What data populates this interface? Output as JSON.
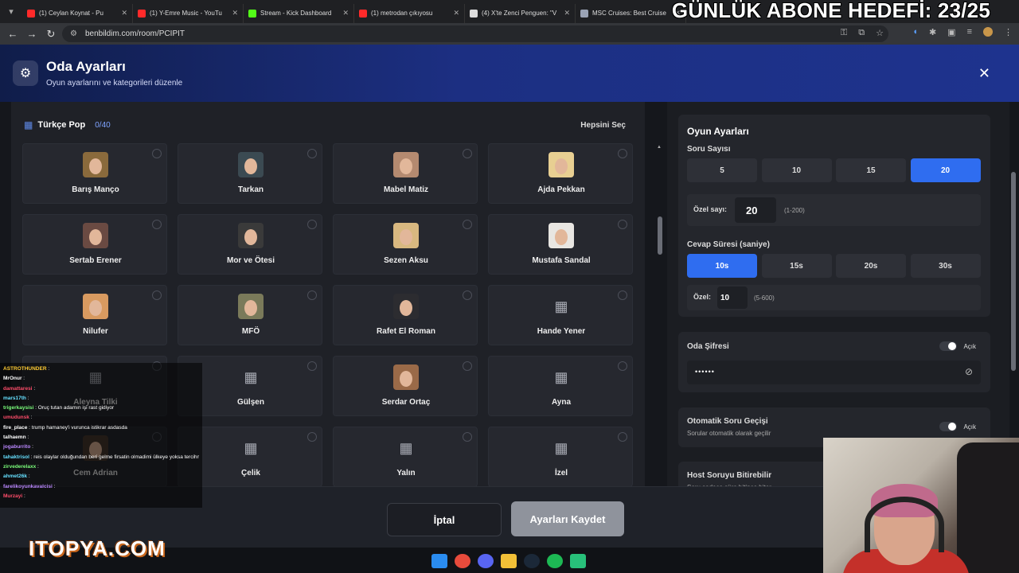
{
  "browser": {
    "tabs": [
      {
        "label": "(1) Ceylan Koynat - Pu",
        "color": "#ff2a2a"
      },
      {
        "label": "(1) Y-Emre Music - YouTu",
        "color": "#ff2a2a"
      },
      {
        "label": "Stream - Kick Dashboard",
        "color": "#53fc18"
      },
      {
        "label": "(1) metrodan çıkıyosu",
        "color": "#ff2a2a"
      },
      {
        "label": "(4) X'te Zenci Penguen: \"V",
        "color": "#dddddd"
      },
      {
        "label": "MSC Cruises: Best Cruise",
        "color": "#9aa3b5"
      }
    ],
    "url": "benbildim.com/room/PCIPIT",
    "goal_text": "GÜNLÜK ABONE HEDEFİ: 23/25"
  },
  "header": {
    "title": "Oda Ayarları",
    "subtitle": "Oyun ayarlarını ve kategorileri düzenle"
  },
  "category": {
    "name": "Türkçe Pop",
    "count": "0/40",
    "select_all": "Hepsini Seç",
    "artists": [
      {
        "name": "Barış Manço",
        "avatar": "#8a6a3c"
      },
      {
        "name": "Tarkan",
        "avatar": "#3b4a52"
      },
      {
        "name": "Mabel Matiz",
        "avatar": "#b48a70"
      },
      {
        "name": "Ajda Pekkan",
        "avatar": "#e8cf92"
      },
      {
        "name": "Sertab Erener",
        "avatar": "#6a4a42"
      },
      {
        "name": "Mor ve Ötesi",
        "avatar": "#3a3a3a"
      },
      {
        "name": "Sezen Aksu",
        "avatar": "#d8b880"
      },
      {
        "name": "Mustafa Sandal",
        "avatar": "#e8e6e2"
      },
      {
        "name": "Nilufer",
        "avatar": "#d89a60"
      },
      {
        "name": "MFÖ",
        "avatar": "#7a7a5a"
      },
      {
        "name": "Rafet El Roman",
        "avatar": "#2c2c30"
      },
      {
        "name": "Hande Yener",
        "avatar": ""
      },
      {
        "name": "Aleyna Tilki",
        "avatar": ""
      },
      {
        "name": "Gülşen",
        "avatar": ""
      },
      {
        "name": "Serdar Ortaç",
        "avatar": "#9a6a48"
      },
      {
        "name": "Ayna",
        "avatar": ""
      },
      {
        "name": "Cem Adrian",
        "avatar": "#4a3a30"
      },
      {
        "name": "Çelik",
        "avatar": ""
      },
      {
        "name": "Yalın",
        "avatar": ""
      },
      {
        "name": "İzel",
        "avatar": ""
      }
    ]
  },
  "settings": {
    "title": "Oyun Ayarları",
    "question_count": {
      "label": "Soru Sayısı",
      "options": [
        "5",
        "10",
        "15",
        "20"
      ],
      "selected": 3,
      "custom_label": "Özel sayı:",
      "custom_value": "20",
      "custom_hint": "(1-200)"
    },
    "answer_time": {
      "label": "Cevap Süresi (saniye)",
      "options": [
        "10s",
        "15s",
        "20s",
        "30s"
      ],
      "selected": 0,
      "custom_label": "Özel:",
      "custom_value": "10",
      "custom_hint": "(5-600)"
    },
    "password": {
      "label": "Oda Şifresi",
      "toggle_label": "Açık",
      "value": "••••••"
    },
    "auto_next": {
      "label": "Otomatik Soru Geçişi",
      "desc": "Sorular otomatik olarak geçilir",
      "toggle_label": "Açık"
    },
    "host_finish": {
      "label": "Host Soruyu Bitirebilir",
      "desc": "Soru sadece süre bitince biter"
    }
  },
  "footer": {
    "cancel": "İptal",
    "save": "Ayarları Kaydet"
  },
  "chat": [
    {
      "user": "ASTROTHUNDER",
      "msg": ":",
      "color": "#ffcc33"
    },
    {
      "user": "MrOnur",
      "msg": ":",
      "color": "#ffffff"
    },
    {
      "user": "damattaresi",
      "msg": ":",
      "color": "#ff4d6a"
    },
    {
      "user": "mars17th",
      "msg": ":",
      "color": "#66e0ff"
    },
    {
      "user": "trigerkaysisi",
      "msg": ": Oruç tutan adamın işi rast gidiyor",
      "color": "#7cff7c"
    },
    {
      "user": "umudunsk",
      "msg": ":",
      "color": "#ff4d6a"
    },
    {
      "user": "fire_place",
      "msg": ": trump hamaney'i vurunca istikrar asdasda",
      "color": "#ffffff"
    },
    {
      "user": "talhaemn",
      "msg": ":",
      "color": "#ffffff"
    },
    {
      "user": "jogaburrito",
      "msg": ":",
      "color": "#bb88ff"
    },
    {
      "user": "tahaktrisol",
      "msg": ": reis olaylar olduğundan beri gelme firsatin olmadimi ülkeye yoksa tercihmi etmedin",
      "color": "#66e0ff"
    },
    {
      "user": "zirvederelaxx",
      "msg": ":",
      "color": "#7cff7c"
    },
    {
      "user": "ahmet26k",
      "msg": ":",
      "color": "#66e0ff"
    },
    {
      "user": "farelikoyunkavalcisi",
      "msg": ":",
      "color": "#bb88ff"
    },
    {
      "user": "Murzayi",
      "msg": ":",
      "color": "#ff4d6a"
    }
  ],
  "overlay": {
    "logo": "ITOPYA.COM"
  }
}
